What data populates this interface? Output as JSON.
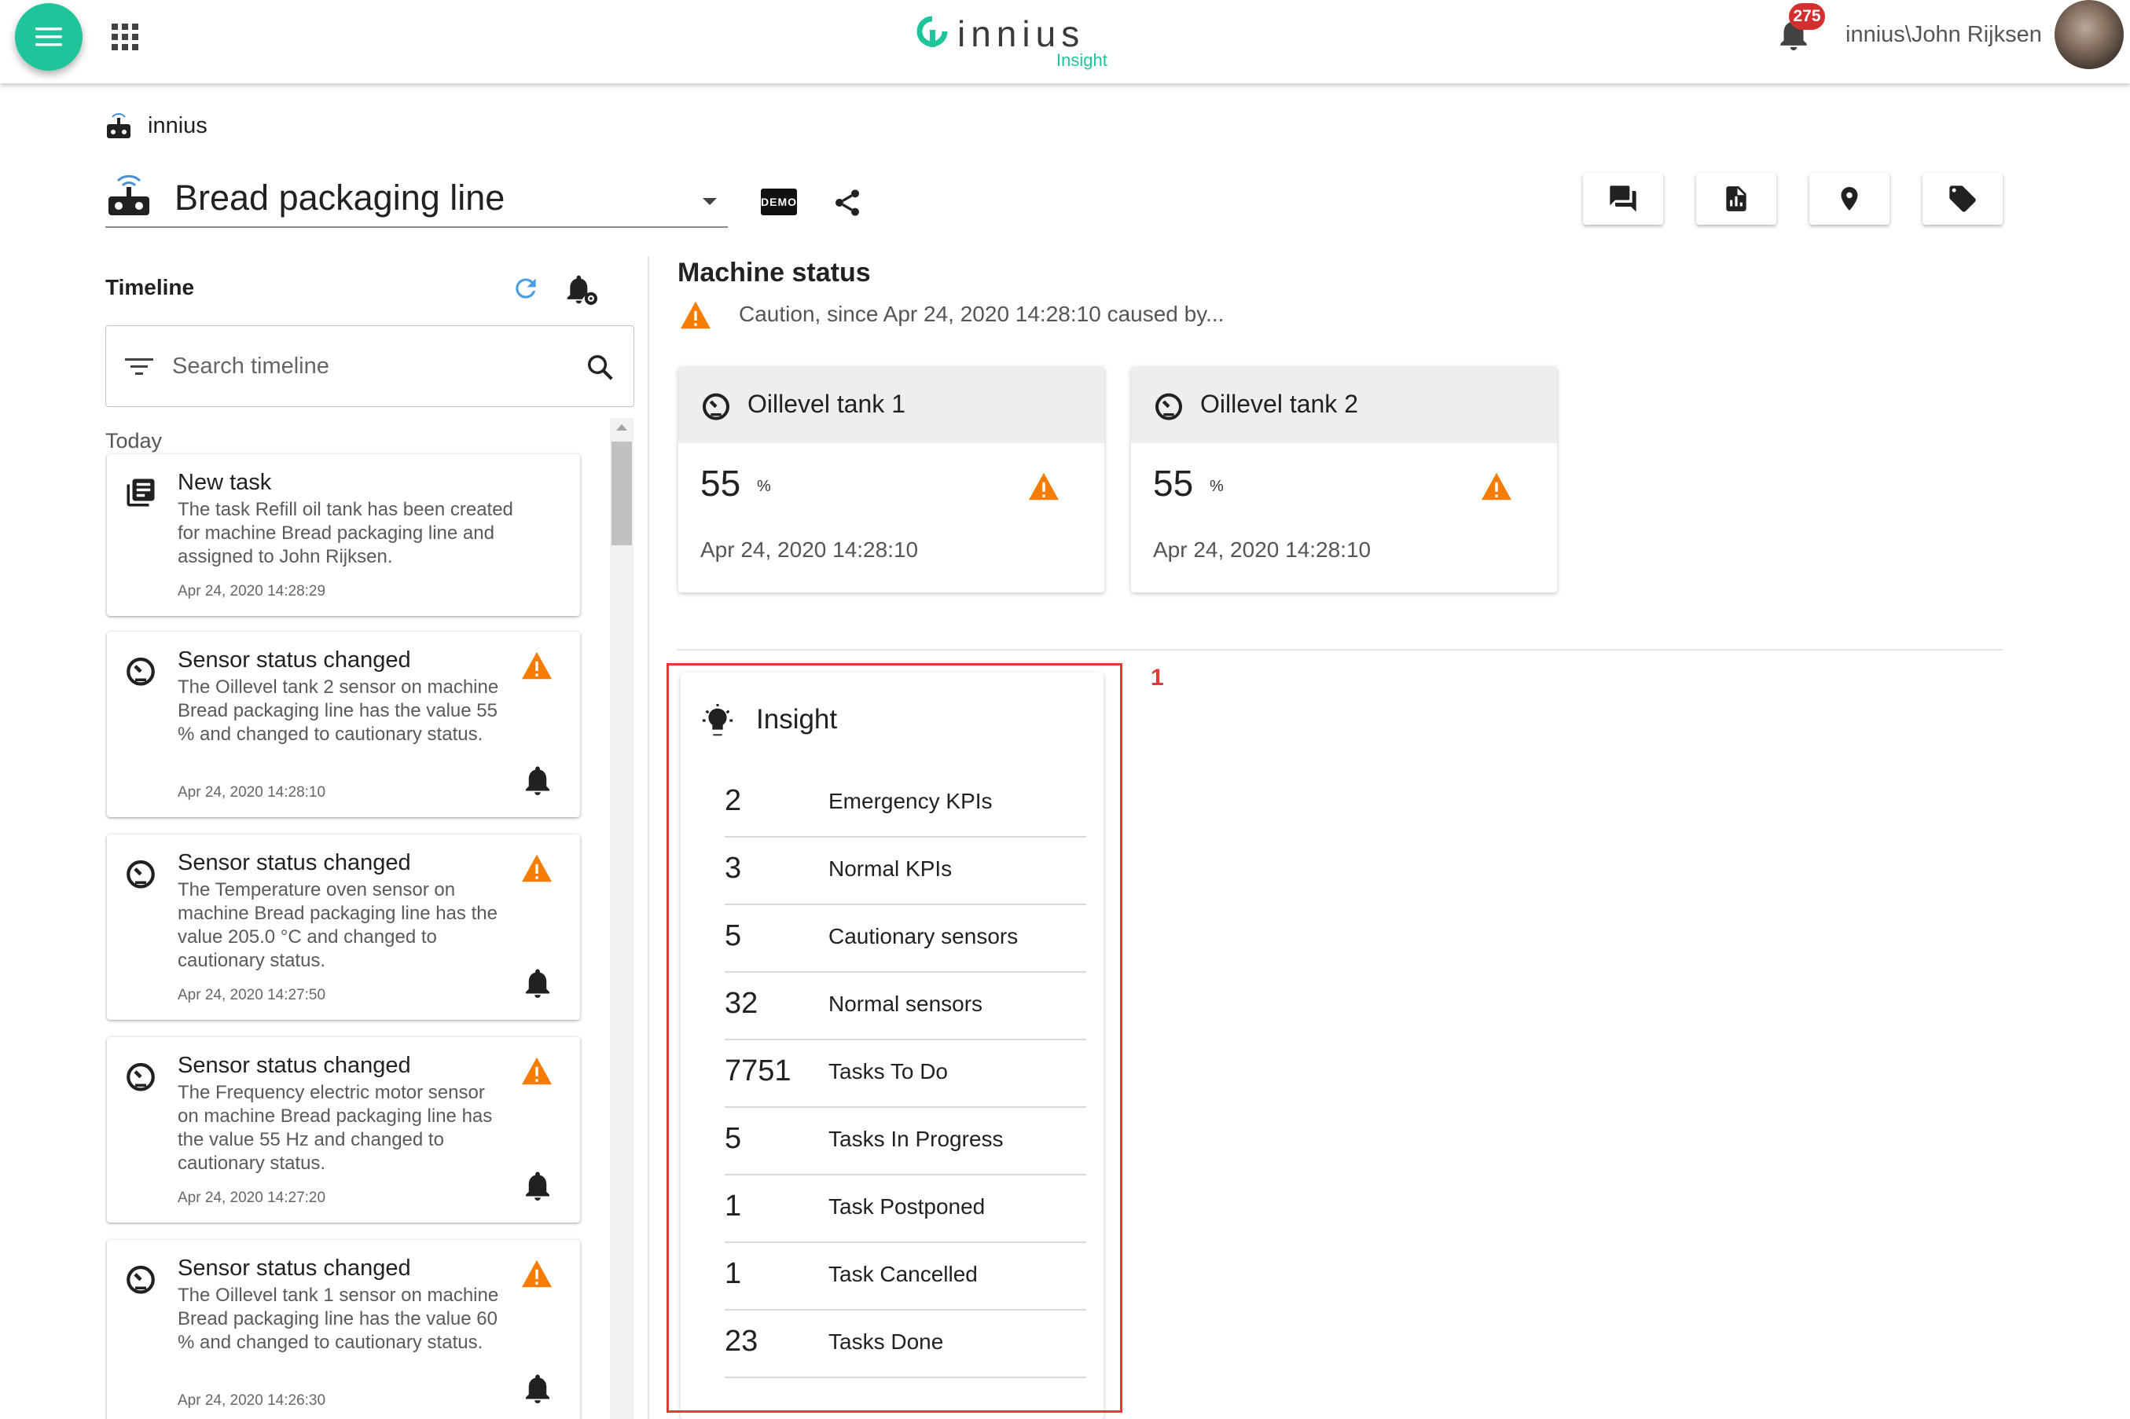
{
  "header": {
    "logo_word": "innius",
    "logo_sub": "Insight",
    "notification_count": "275",
    "user_name": "innius\\John Rijksen"
  },
  "breadcrumb": {
    "label": "innius"
  },
  "machine": {
    "name": "Bread packaging line",
    "demo_label": "DEMO"
  },
  "timeline": {
    "title": "Timeline",
    "search_placeholder": "Search timeline",
    "group_label": "Today",
    "items": [
      {
        "title": "New task",
        "text": "The task Refill oil tank has been created for machine Bread packaging line and assigned to John Rijksen.",
        "time": "Apr 24, 2020 14:28:29",
        "icon": "task-icon",
        "warning": false
      },
      {
        "title": "Sensor status changed",
        "text": "The Oillevel tank 2 sensor on machine Bread packaging line has the value 55 % and changed to cautionary status.",
        "time": "Apr 24, 2020 14:28:10",
        "icon": "gauge-icon",
        "warning": true
      },
      {
        "title": "Sensor status changed",
        "text": "The Temperature oven sensor on machine Bread packaging line has the value 205.0 °C and changed to cautionary status.",
        "time": "Apr 24, 2020 14:27:50",
        "icon": "gauge-icon",
        "warning": true
      },
      {
        "title": "Sensor status changed",
        "text": "The Frequency electric motor sensor on machine Bread packaging line has the value 55 Hz and changed to cautionary status.",
        "time": "Apr 24, 2020 14:27:20",
        "icon": "gauge-icon",
        "warning": true
      },
      {
        "title": "Sensor status changed",
        "text": "The Oillevel tank 1 sensor on machine Bread packaging line has the value 60 % and changed to cautionary status.",
        "time": "Apr 24, 2020 14:26:30",
        "icon": "gauge-icon",
        "warning": true
      }
    ]
  },
  "machine_status": {
    "title": "Machine status",
    "status_text": "Caution, since Apr 24, 2020 14:28:10 caused by...",
    "status_color": "#f57c00",
    "sensors": [
      {
        "name": "Oillevel tank 1",
        "value": "55",
        "unit": "%",
        "time": "Apr 24, 2020 14:28:10"
      },
      {
        "name": "Oillevel tank 2",
        "value": "55",
        "unit": "%",
        "time": "Apr 24, 2020 14:28:10"
      }
    ]
  },
  "insight": {
    "title": "Insight",
    "annotation_number": "1",
    "rows": [
      {
        "value": "2",
        "label": "Emergency KPIs"
      },
      {
        "value": "3",
        "label": "Normal KPIs"
      },
      {
        "value": "5",
        "label": "Cautionary sensors"
      },
      {
        "value": "32",
        "label": "Normal sensors"
      },
      {
        "value": "7751",
        "label": "Tasks To Do"
      },
      {
        "value": "5",
        "label": "Tasks In Progress"
      },
      {
        "value": "1",
        "label": "Task Postponed"
      },
      {
        "value": "1",
        "label": "Task Cancelled"
      },
      {
        "value": "23",
        "label": "Tasks Done"
      }
    ]
  },
  "colors": {
    "accent": "#1fc49b",
    "warning": "#f57c00",
    "badge": "#d32f2f",
    "annotation": "#e53935"
  }
}
